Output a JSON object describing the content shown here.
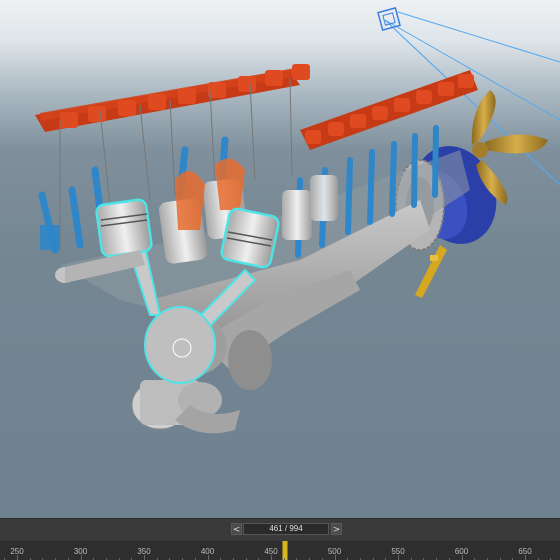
{
  "viewport": {
    "scene": "engine-model",
    "colors": {
      "background_top": "#eef1f3",
      "background_bottom": "#6f8290",
      "selection_outline": "#4fe3e6",
      "valve_red": "#d4421c",
      "spring_blue": "#2f86c9",
      "piston_gray": "#d9d9d9",
      "propeller_blue": "#2a3fa8",
      "propeller_gold": "#b98a2a",
      "camera_line": "#53a9ef"
    }
  },
  "timeline": {
    "prev_label": "<",
    "next_label": ">",
    "frame_display": "461 / 994",
    "current_frame": 461,
    "total_frames": 994,
    "ruler_labels": [
      "250",
      "300",
      "350",
      "400",
      "450",
      "500",
      "550",
      "600",
      "650"
    ],
    "accent_color": "#d6b81e"
  }
}
